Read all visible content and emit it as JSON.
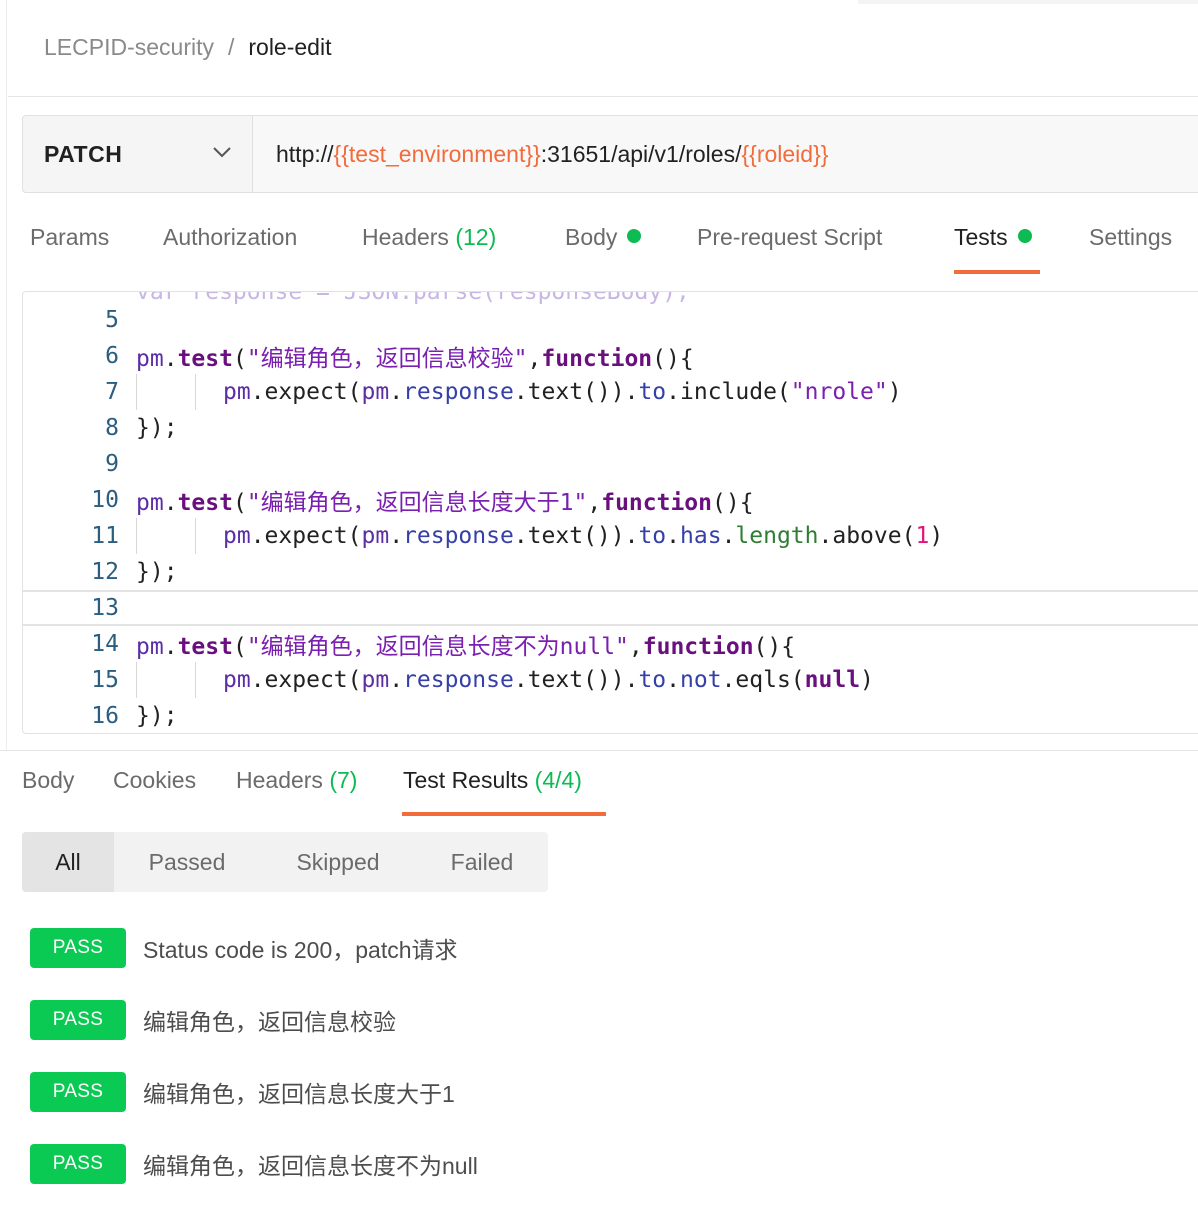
{
  "breadcrumb": {
    "parent": "LECPID-security",
    "separator": "/",
    "current": "role-edit"
  },
  "request": {
    "method": "PATCH",
    "url_parts": [
      "http://",
      "{{test_environment}}",
      ":31651/api/v1/roles/",
      "{{roleid}}"
    ]
  },
  "request_tabs": {
    "params": "Params",
    "authorization": "Authorization",
    "headers": "Headers",
    "headers_count": "(12)",
    "body": "Body",
    "prerequest": "Pre-request Script",
    "tests": "Tests",
    "settings": "Settings",
    "active": "Tests"
  },
  "editor": {
    "line_numbers": [
      "5",
      "6",
      "7",
      "8",
      "9",
      "10",
      "11",
      "12",
      "13",
      "14",
      "15",
      "16"
    ],
    "code": {
      "l6_str": "\"编辑角色，返回信息校验\"",
      "l7_str": "\"nrole\"",
      "l10_str": "\"编辑角色，返回信息长度大于1\"",
      "l11_num": "1",
      "l14_str": "\"编辑角色，返回信息长度不为null\""
    }
  },
  "response_tabs": {
    "body": "Body",
    "cookies": "Cookies",
    "headers": "Headers",
    "headers_count": "(7)",
    "test_results": "Test Results",
    "test_results_count": "(4/4)",
    "active": "Test Results"
  },
  "filters": {
    "all": "All",
    "passed": "Passed",
    "skipped": "Skipped",
    "failed": "Failed",
    "active": "All"
  },
  "results": [
    {
      "status": "PASS",
      "name": "Status code is 200，patch请求"
    },
    {
      "status": "PASS",
      "name": "编辑角色，返回信息校验"
    },
    {
      "status": "PASS",
      "name": "编辑角色，返回信息长度大于1"
    },
    {
      "status": "PASS",
      "name": "编辑角色，返回信息长度不为null"
    }
  ],
  "colors": {
    "accent": "#f26b3a",
    "success": "#0cbb52",
    "pass_badge": "#0bca53"
  },
  "icons": {
    "method_dropdown": "chevron-down-icon",
    "status_dot": "dot-icon"
  }
}
